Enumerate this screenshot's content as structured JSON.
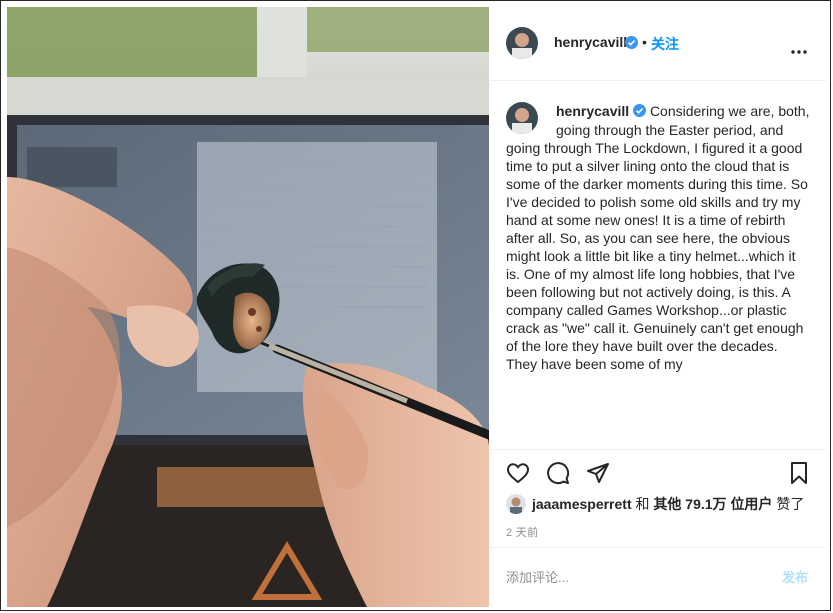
{
  "post": {
    "username": "henrycavill",
    "separator": "•",
    "follow_label": "关注",
    "more_icon": "more-horizontal-icon",
    "verified_icon": "verified-badge-icon",
    "caption_username": "henrycavill",
    "caption_text": "Considering we are, both, going through the Easter period, and going through The Lockdown, I figured it a good time to put a silver lining onto the cloud that is some of the darker moments during this time. So I've decided to polish some old skills and try my hand at some new ones! It is a time of rebirth after all. So, as you can see here, the obvious might look a little bit like a tiny helmet...which it is. One of my almost life long hobbies, that I've been following but not actively doing, is this. A company called Games Workshop...or plastic crack as \"we\" call it. Genuinely can't get enough of the lore they have built over the decades. They have been some of my",
    "actions": {
      "like_icon": "heart-icon",
      "comment_icon": "comment-icon",
      "share_icon": "share-icon",
      "save_icon": "bookmark-icon"
    },
    "likes": {
      "liker": "jaaamesperrett",
      "connector": "和",
      "others_label": "其他",
      "count": "79.1万",
      "users_label": "位用户",
      "liked_label": "赞了"
    },
    "timestamp": "2 天前",
    "comment_placeholder": "添加评论...",
    "post_button": "发布"
  },
  "colors": {
    "accent": "#0095f6",
    "post_disabled": "#b2dffc",
    "verified": "#3897f0",
    "text": "#262626",
    "muted": "#8e8e8e"
  }
}
